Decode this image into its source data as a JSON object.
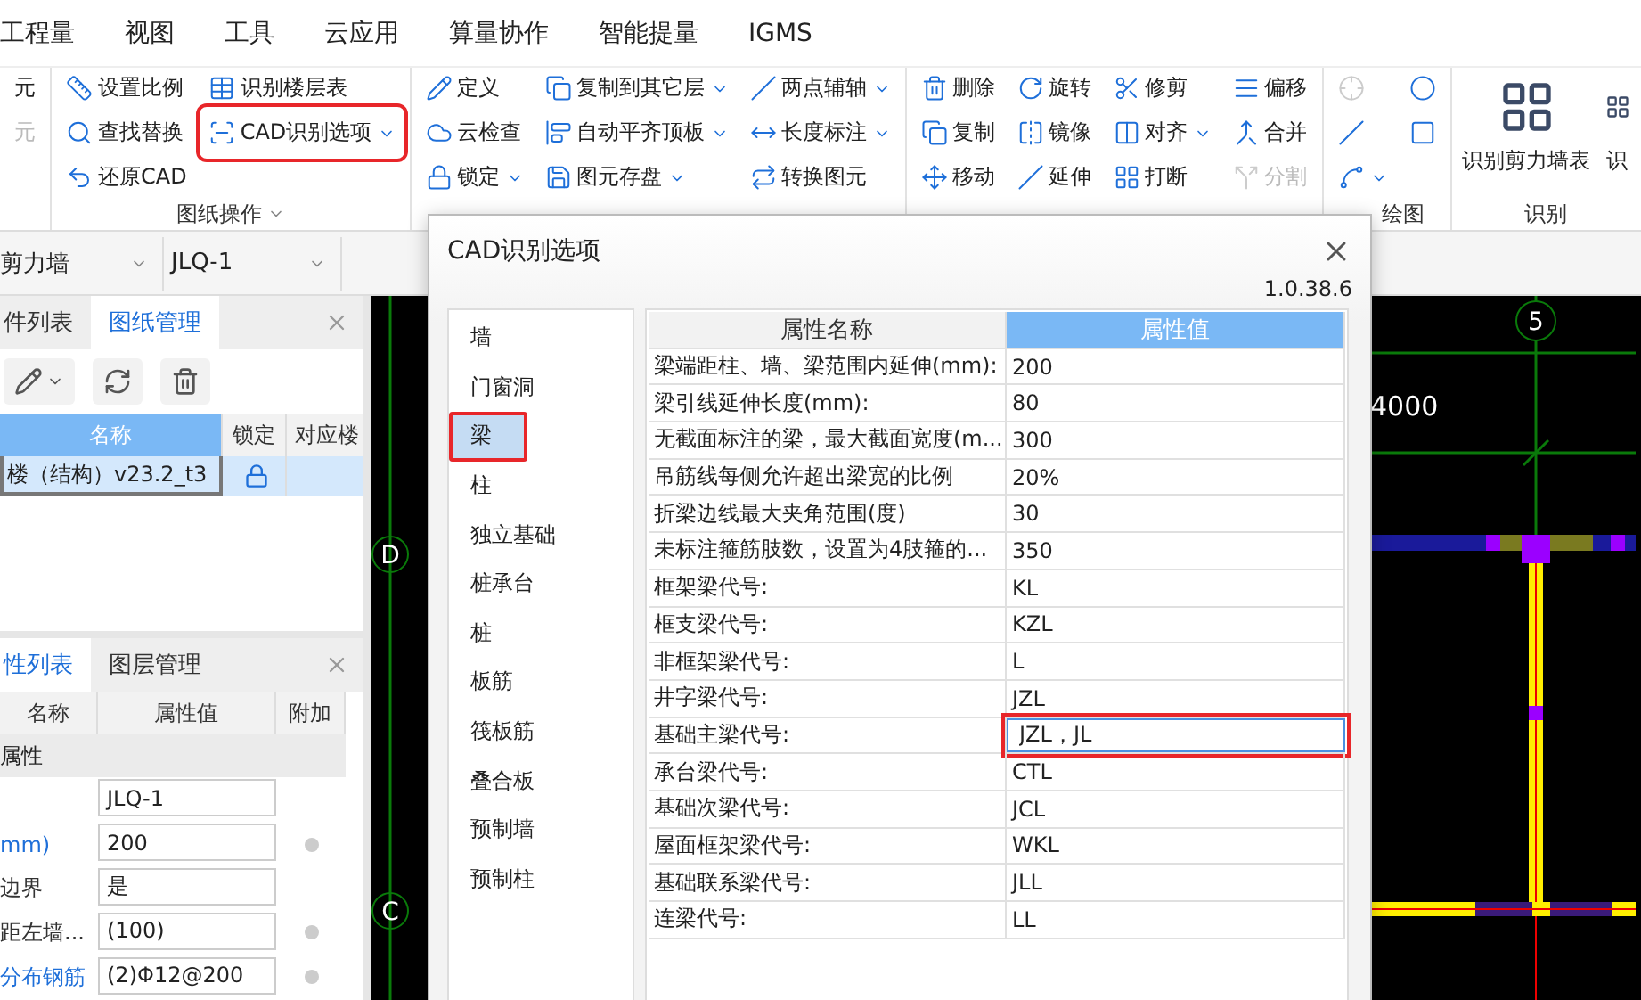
{
  "menu": [
    {
      "label": "工程量"
    },
    {
      "label": "视图"
    },
    {
      "label": "工具"
    },
    {
      "label": "云应用"
    },
    {
      "label": "算量协作"
    },
    {
      "label": "智能提量"
    },
    {
      "label": "IGMS"
    }
  ],
  "ribbon": {
    "groups": [
      {
        "columns": [
          [
            {
              "label": "元",
              "dropdown": false,
              "disabled": false,
              "highlighted": false
            },
            {
              "label": "元",
              "dropdown": false,
              "disabled": true,
              "highlighted": false
            }
          ]
        ]
      },
      {
        "label": "图纸操作",
        "label_menu": true,
        "columns": [
          [
            {
              "label": "设置比例",
              "dropdown": false,
              "disabled": false,
              "highlighted": false
            },
            {
              "label": "查找替换",
              "dropdown": false,
              "disabled": false,
              "highlighted": false
            },
            {
              "label": "还原CAD",
              "dropdown": false,
              "disabled": false,
              "highlighted": false
            }
          ],
          [
            {
              "label": "识别楼层表",
              "dropdown": false,
              "disabled": false,
              "highlighted": false
            },
            {
              "label": "CAD识别选项",
              "dropdown": true,
              "disabled": false,
              "highlighted": true
            }
          ]
        ]
      },
      {
        "columns": [
          [
            {
              "label": "定义",
              "dropdown": false,
              "disabled": false,
              "highlighted": false
            },
            {
              "label": "云检查",
              "dropdown": false,
              "disabled": false,
              "highlighted": false
            },
            {
              "label": "锁定",
              "dropdown": true,
              "disabled": false,
              "highlighted": false
            }
          ],
          [
            {
              "label": "复制到其它层",
              "dropdown": true,
              "disabled": false,
              "highlighted": false
            },
            {
              "label": "自动平齐顶板",
              "dropdown": true,
              "disabled": false,
              "highlighted": false
            },
            {
              "label": "图元存盘",
              "dropdown": true,
              "disabled": false,
              "highlighted": false
            }
          ],
          [
            {
              "label": "两点辅轴",
              "dropdown": true,
              "disabled": false,
              "highlighted": false
            },
            {
              "label": "长度标注",
              "dropdown": true,
              "disabled": false,
              "highlighted": false
            },
            {
              "label": "转换图元",
              "dropdown": false,
              "disabled": false,
              "highlighted": false
            }
          ]
        ]
      },
      {
        "columns": [
          [
            {
              "label": "删除",
              "dropdown": false,
              "disabled": false,
              "highlighted": false
            },
            {
              "label": "复制",
              "dropdown": false,
              "disabled": false,
              "highlighted": false
            },
            {
              "label": "移动",
              "dropdown": false,
              "disabled": false,
              "highlighted": false
            }
          ],
          [
            {
              "label": "旋转",
              "dropdown": false,
              "disabled": false,
              "highlighted": false
            },
            {
              "label": "镜像",
              "dropdown": false,
              "disabled": false,
              "highlighted": false
            },
            {
              "label": "延伸",
              "dropdown": false,
              "disabled": false,
              "highlighted": false
            }
          ],
          [
            {
              "label": "修剪",
              "dropdown": false,
              "disabled": false,
              "highlighted": false
            },
            {
              "label": "对齐",
              "dropdown": true,
              "disabled": false,
              "highlighted": false
            },
            {
              "label": "打断",
              "dropdown": false,
              "disabled": false,
              "highlighted": false
            }
          ],
          [
            {
              "label": "偏移",
              "dropdown": false,
              "disabled": false,
              "highlighted": false
            },
            {
              "label": "合并",
              "dropdown": false,
              "disabled": false,
              "highlighted": false
            },
            {
              "label": "分割",
              "dropdown": false,
              "disabled": true,
              "highlighted": false
            }
          ]
        ]
      },
      {
        "label": "绘图",
        "columns": [
          [
            {
              "dropdown": false,
              "disabled": true,
              "highlighted": false
            },
            {
              "dropdown": false,
              "disabled": false,
              "highlighted": false
            },
            {
              "dropdown": true,
              "disabled": false,
              "highlighted": false
            }
          ],
          [
            {
              "dropdown": false,
              "disabled": false,
              "highlighted": false
            },
            {
              "dropdown": false,
              "disabled": false,
              "highlighted": false
            }
          ]
        ]
      },
      {
        "label": "识别",
        "large": [
          {
            "label": "识别剪力墙表"
          },
          {
            "label": "识"
          }
        ]
      }
    ]
  },
  "selectors": [
    {
      "value": "剪力墙"
    },
    {
      "value": "JLQ-1"
    }
  ],
  "drawing_panel": {
    "tabs": [
      {
        "label": "件列表",
        "selected": false
      },
      {
        "label": "图纸管理",
        "selected": true
      }
    ],
    "columns": [
      "名称",
      "锁定",
      "对应楼"
    ],
    "rows": [
      {
        "name": "楼（结构）v23.2_t3",
        "locked": true,
        "selected": true
      }
    ]
  },
  "property_panel": {
    "tabs": [
      {
        "label": "性列表",
        "selected": true
      },
      {
        "label": "图层管理",
        "selected": false
      }
    ],
    "columns": [
      "名称",
      "属性值",
      "附加"
    ],
    "rows": [
      {
        "kind": "group",
        "name": "属性"
      },
      {
        "kind": "row",
        "value": "JLQ-1",
        "extra": false
      },
      {
        "kind": "row",
        "name": "mm)",
        "value": "200",
        "linked": true,
        "extra": true
      },
      {
        "kind": "row",
        "name": "边界",
        "value": "是",
        "linked": false,
        "extra": false
      },
      {
        "kind": "row",
        "name": "距左墙...",
        "value": "(100)",
        "linked": false,
        "extra": true
      },
      {
        "kind": "row",
        "name": "分布钢筋",
        "value": "(2)Φ12@200",
        "linked": true,
        "extra": true
      }
    ]
  },
  "canvas": {
    "axes": [
      "D",
      "C",
      "5"
    ],
    "dimension": "4000"
  },
  "dialog": {
    "title": "CAD识别选项",
    "version": "1.0.38.6",
    "categories": [
      {
        "label": "墙",
        "selected": false,
        "highlighted": false
      },
      {
        "label": "门窗洞",
        "selected": false,
        "highlighted": false
      },
      {
        "label": "梁",
        "selected": true,
        "highlighted": true
      },
      {
        "label": "柱",
        "selected": false,
        "highlighted": false
      },
      {
        "label": "独立基础",
        "selected": false,
        "highlighted": false
      },
      {
        "label": "桩承台",
        "selected": false,
        "highlighted": false
      },
      {
        "label": "桩",
        "selected": false,
        "highlighted": false
      },
      {
        "label": "板筋",
        "selected": false,
        "highlighted": false
      },
      {
        "label": "筏板筋",
        "selected": false,
        "highlighted": false
      },
      {
        "label": "叠合板",
        "selected": false,
        "highlighted": false
      },
      {
        "label": "预制墙",
        "selected": false,
        "highlighted": false
      },
      {
        "label": "预制柱",
        "selected": false,
        "highlighted": false
      }
    ],
    "columns": [
      {
        "label": "属性名称",
        "selected": false
      },
      {
        "label": "属性值",
        "selected": true
      }
    ],
    "rows": [
      {
        "name": "梁端距柱、墙、梁范围内延伸(mm):",
        "value": "200",
        "editing": false
      },
      {
        "name": "梁引线延伸长度(mm):",
        "value": "80",
        "editing": false
      },
      {
        "name": "无截面标注的梁，最大截面宽度(m...",
        "value": "300",
        "editing": false
      },
      {
        "name": "吊筋线每侧允许超出梁宽的比例",
        "value": "20%",
        "editing": false
      },
      {
        "name": "折梁边线最大夹角范围(度)",
        "value": "30",
        "editing": false
      },
      {
        "name": "未标注箍筋肢数，设置为4肢箍的...",
        "value": "350",
        "editing": false
      },
      {
        "name": "框架梁代号:",
        "value": "KL",
        "editing": false
      },
      {
        "name": "框支梁代号:",
        "value": "KZL",
        "editing": false
      },
      {
        "name": "非框架梁代号:",
        "value": "L",
        "editing": false
      },
      {
        "name": "井字梁代号:",
        "value": "JZL",
        "editing": false
      },
      {
        "name": "基础主梁代号:",
        "value": "JZL，JL",
        "editing": true
      },
      {
        "name": "承台梁代号:",
        "value": "CTL",
        "editing": false
      },
      {
        "name": "基础次梁代号:",
        "value": "JCL",
        "editing": false
      },
      {
        "name": "屋面框架梁代号:",
        "value": "WKL",
        "editing": false
      },
      {
        "name": "基础联系梁代号:",
        "value": "JLL",
        "editing": false
      },
      {
        "name": "连梁代号:",
        "value": "LL",
        "editing": false
      }
    ]
  }
}
